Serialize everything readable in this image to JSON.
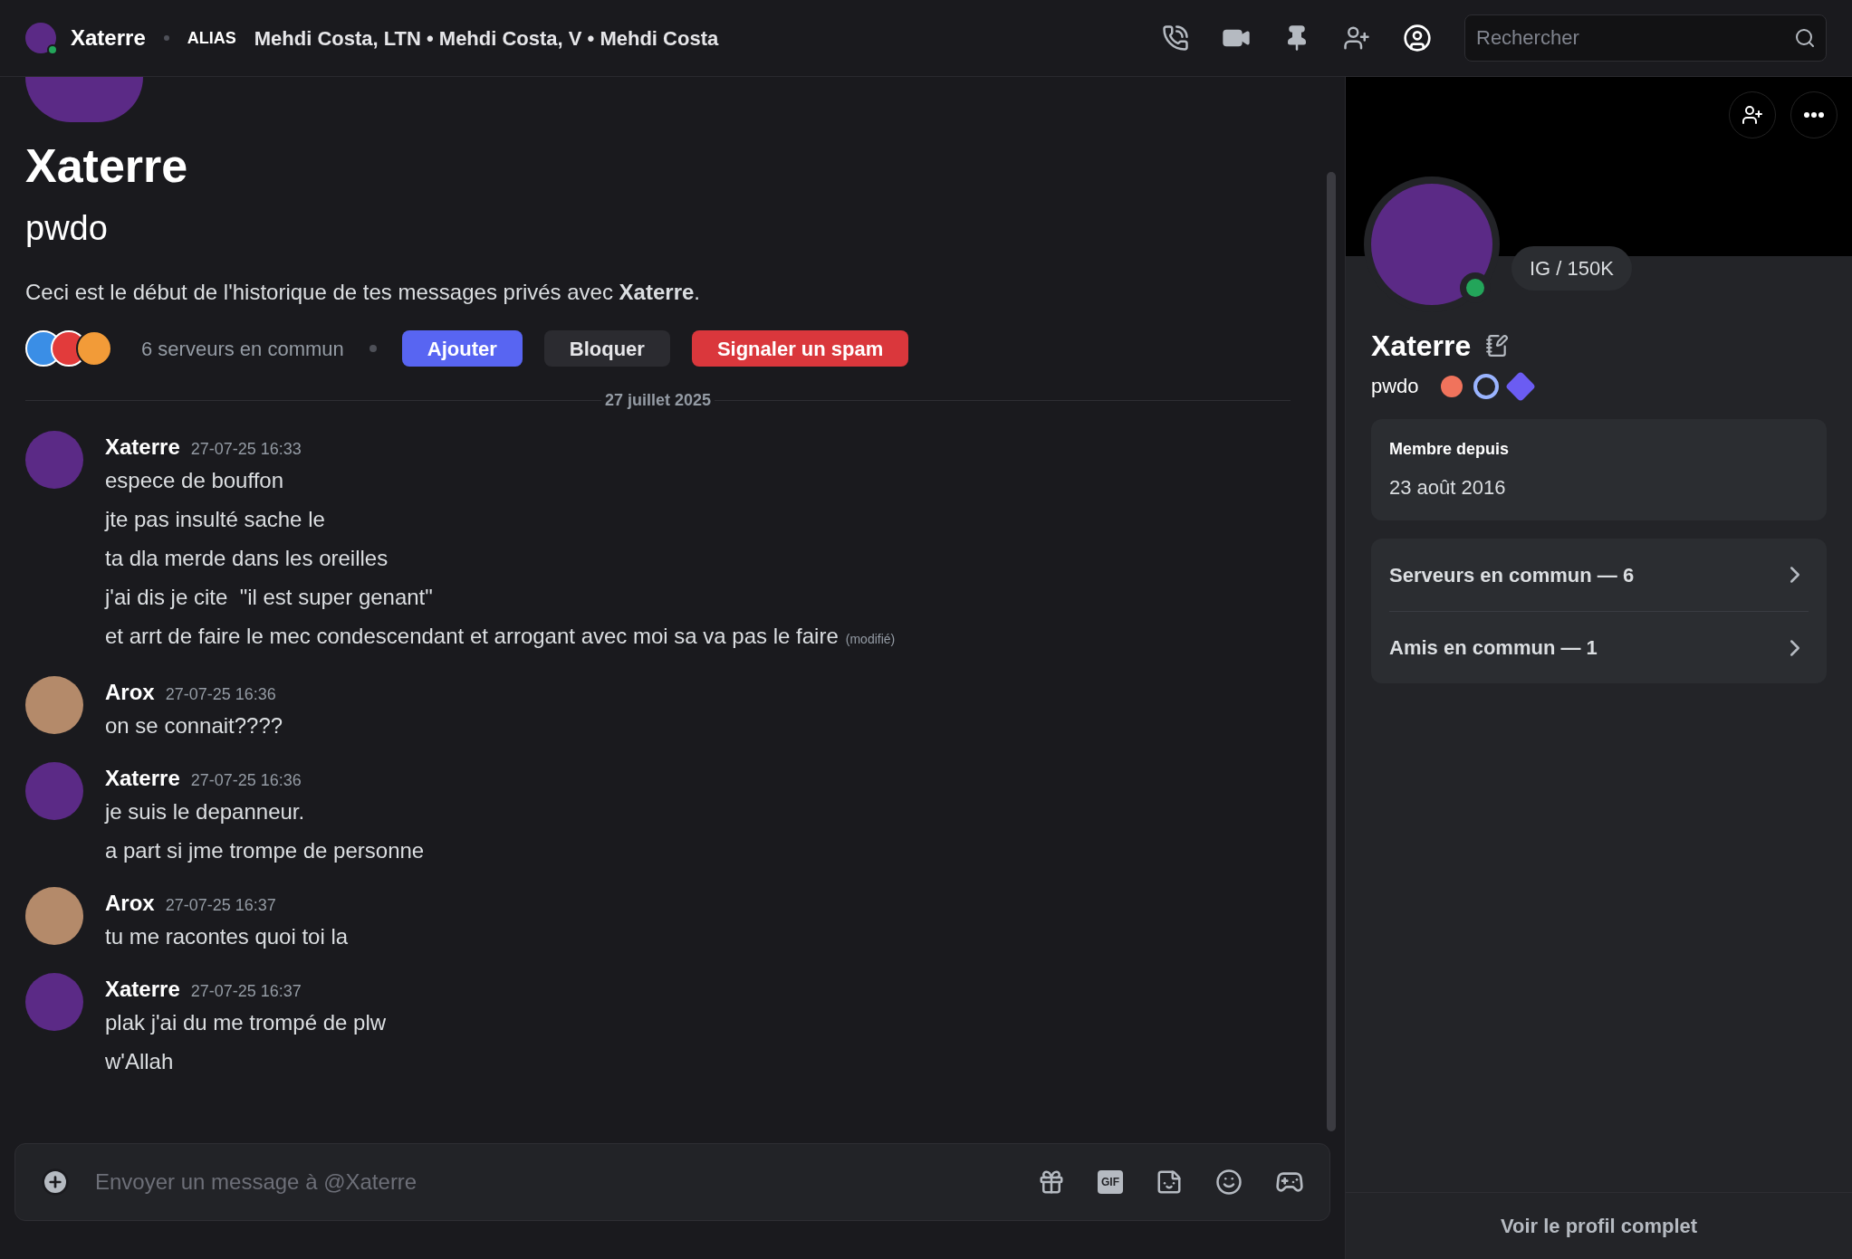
{
  "top_bar": {
    "name": "Xaterre",
    "alias_label": "ALIAS",
    "aliases": "Mehdi Costa, LTN • Mehdi Costa, V • Mehdi Costa",
    "search": {
      "placeholder": "Rechercher"
    }
  },
  "intro": {
    "title": "Xaterre",
    "username": "pwdo",
    "text": "Ceci est le début de l'historique de tes messages privés avec **Xaterre**.",
    "servers_in_common": "6 serveurs en commun",
    "buttons": [
      {
        "label": "Ajouter",
        "kind": "primary"
      },
      {
        "label": "Bloquer",
        "kind": "secondary"
      },
      {
        "label": "Signaler un spam",
        "kind": "danger"
      }
    ]
  },
  "date_divider": "27 juillet 2025",
  "messages": [
    {
      "author": "Xaterre",
      "time": "27-07-25 16:33",
      "kind": "cat",
      "lines": [
        {
          "text": "espece de bouffon"
        },
        {
          "text": "jte pas insulté sache le"
        },
        {
          "text": "ta dla merde dans les oreilles"
        },
        {
          "text": "j'ai dis je cite  \"il est super genant\""
        },
        {
          "text": "et arrt de faire le mec condescendant et arrogant avec moi sa va pas le faire",
          "edited": "(modifié)"
        }
      ]
    },
    {
      "author": "Arox",
      "time": "27-07-25 16:36",
      "kind": "photo",
      "lines": [
        {
          "text": "on se connait????"
        }
      ]
    },
    {
      "author": "Xaterre",
      "time": "27-07-25 16:36",
      "kind": "cat",
      "lines": [
        {
          "text": "je suis le depanneur."
        },
        {
          "text": "a part si jme trompe de personne"
        }
      ]
    },
    {
      "author": "Arox",
      "time": "27-07-25 16:37",
      "kind": "photo",
      "lines": [
        {
          "text": "tu me racontes quoi toi la"
        }
      ]
    },
    {
      "author": "Xaterre",
      "time": "27-07-25 16:37",
      "kind": "cat",
      "lines": [
        {
          "text": "plak j'ai du me trompé de plw"
        },
        {
          "text": "w'Allah"
        }
      ]
    }
  ],
  "composer": {
    "placeholder": "Envoyer un message à @Xaterre",
    "gif_label": "GIF"
  },
  "profile": {
    "status": "IG / 150K",
    "name": "Xaterre",
    "username": "pwdo",
    "member_since_label": "Membre depuis",
    "member_since": "23 août 2016",
    "links": [
      "Serveurs en commun — 6",
      "Amis en commun — 1"
    ],
    "footer": "Voir le profil complet"
  }
}
